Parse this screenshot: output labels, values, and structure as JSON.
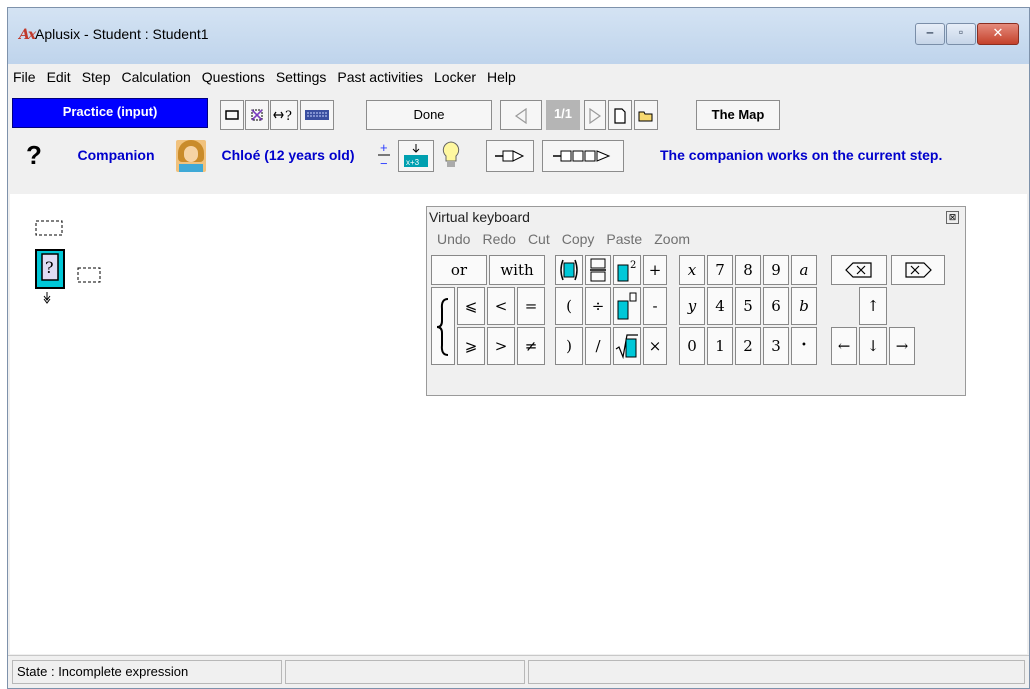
{
  "window": {
    "title": "Aplusix - Student : Student1",
    "app_icon_text": "Ax",
    "controls": {
      "minimize": "‒",
      "maximize": "▫",
      "close": "✕"
    }
  },
  "menubar": {
    "items": [
      "File",
      "Edit",
      "Step",
      "Calculation",
      "Questions",
      "Settings",
      "Past activities",
      "Locker",
      "Help"
    ]
  },
  "toolbar1": {
    "mode_label": "Practice (input)",
    "done_label": "Done",
    "page_indicator": "1/1",
    "map_label": "The Map"
  },
  "toolbar2": {
    "help_label": "?",
    "companion_label": "Companion",
    "companion_name": "Chloé (12 years old)",
    "status_message": "The companion works on the current step."
  },
  "virtual_keyboard": {
    "title": "Virtual keyboard",
    "menu": [
      "Undo",
      "Redo",
      "Cut",
      "Copy",
      "Paste",
      "Zoom"
    ],
    "keys": {
      "or": "or",
      "with": "with",
      "le": "⩽",
      "lt": "<",
      "eq": "=",
      "ge": "⩾",
      "gt": ">",
      "ne": "≠",
      "plus": "+",
      "lparen": "(",
      "div": "÷",
      "minus": "-",
      "rparen": ")",
      "slash": "/",
      "times": "×",
      "x": "x",
      "y": "y",
      "d7": "7",
      "d8": "8",
      "d9": "9",
      "a": "a",
      "d4": "4",
      "d5": "5",
      "d6": "6",
      "b": "b",
      "d0": "0",
      "d1": "1",
      "d2": "2",
      "d3": "3",
      "dot": "•",
      "up": "↑",
      "down": "↓",
      "left": "←",
      "right": "→"
    }
  },
  "statusbar": {
    "state": "State : Incomplete expression"
  },
  "colors": {
    "practice_bg": "#0000ff",
    "companion_text": "#0000cc",
    "box_cyan": "#00c8d8"
  }
}
